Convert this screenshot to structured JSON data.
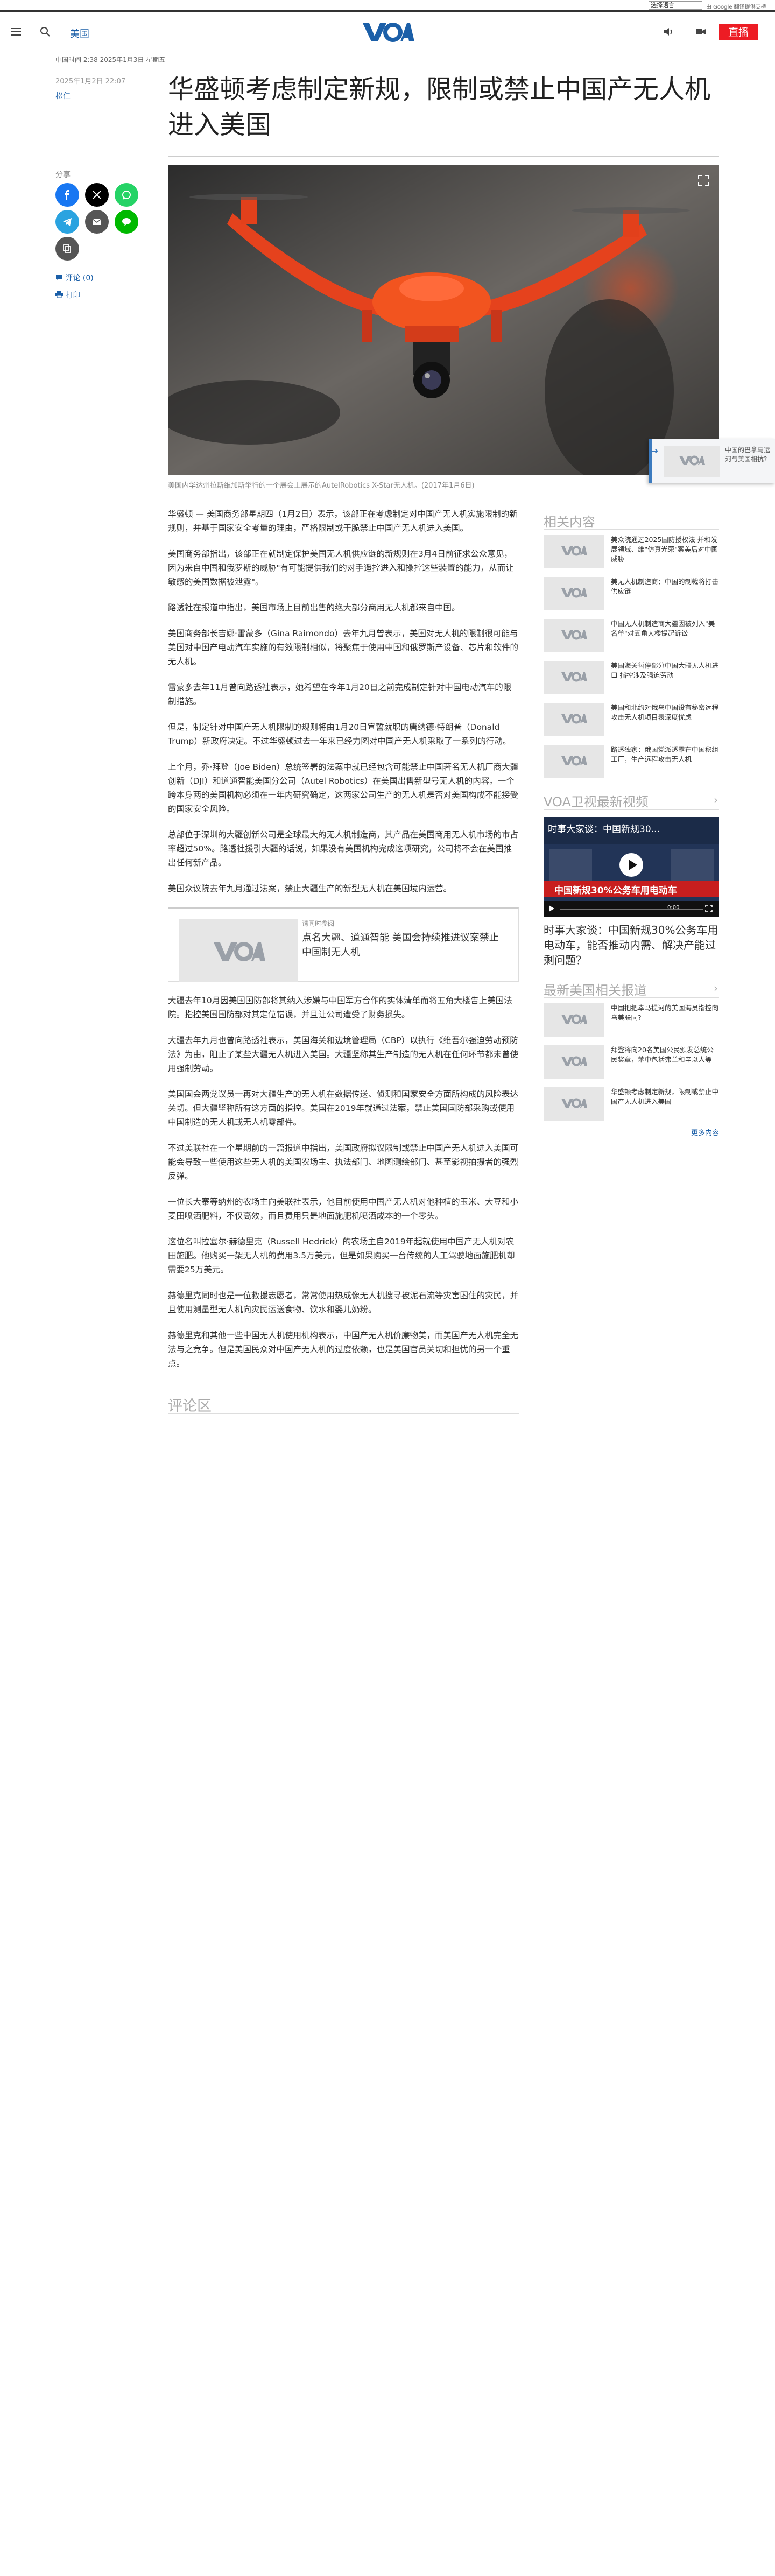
{
  "translate": {
    "select": "选择语言",
    "powered": "由 Google 翻译提供支持"
  },
  "header": {
    "section": "美国",
    "live": "直播"
  },
  "article": {
    "timestamp_line": "中国时间 2:38 2025年1月3日 星期五",
    "date": "2025年1月2日 22:07",
    "author": "松仁",
    "title": "华盛顿考虑制定新规，限制或禁止中国产无人机进入美国",
    "caption": "美国内华达州拉斯维加斯举行的一个展会上展示的AutelRobotics X-Star无人机。(2017年1月6日)",
    "paragraphs": [
      "华盛顿 — 美国商务部星期四（1月2日）表示，该部正在考虑制定对中国产无人机实施限制的新规则，并基于国家安全考量的理由，严格限制或干脆禁止中国产无人机进入美国。",
      "美国商务部指出，该部正在就制定保护美国无人机供应链的新规则在3月4日前征求公众意见，因为来自中国和俄罗斯的威胁\"有可能提供我们的对手遥控进入和操控这些装置的能力，从而让敏感的美国数据被泄露\"。",
      "路透社在报道中指出，美国市场上目前出售的绝大部分商用无人机都来自中国。",
      "美国商务部长吉娜·雷蒙多（Gina Raimondo）去年九月曾表示，美国对无人机的限制很可能与美国对中国产电动汽车实施的有效限制相似，将聚焦于使用中国和俄罗斯产设备、芯片和软件的无人机。",
      "雷蒙多去年11月曾向路透社表示，她希望在今年1月20日之前完成制定针对中国电动汽车的限制措施。",
      "但是，制定针对中国产无人机限制的规则将由1月20日宣誓就职的唐纳德·特朗普（Donald Trump）新政府决定。不过华盛顿过去一年来已经力图对中国产无人机采取了一系列的行动。",
      "上个月，乔·拜登（Joe Biden）总统签署的法案中就已经包含可能禁止中国著名无人机厂商大疆创新（DJI）和道通智能美国分公司（Autel Robotics）在美国出售新型号无人机的内容。一个跨本身两的美国机构必须在一年内研究确定，这两家公司生产的无人机是否对美国构成不能接受的国家安全风险。",
      "总部位于深圳的大疆创新公司是全球最大的无人机制造商，其产品在美国商用无人机市场的市占率超过50%。路透社援引大疆的话说，如果没有美国机构完成这项研究，公司将不会在美国推出任何新产品。",
      "美国众议院去年九月通过法案，禁止大疆生产的新型无人机在美国境内运营。"
    ],
    "related": {
      "kicker": "请同时参阅",
      "title": "点名大疆、道通智能 美国会持续推进议案禁止中国制无人机"
    },
    "paragraphs2": [
      "大疆去年10月因美国国防部将其纳入涉嫌与中国军方合作的实体清单而将五角大楼告上美国法院。指控美国国防部对其定位错误，并且让公司遭受了财务损失。",
      "大疆去年九月也曾向路透社表示，美国海关和边境管理局（CBP）以执行《维吾尔强迫劳动预防法》为由，阻止了某些大疆无人机进入美国。大疆坚称其生产制造的无人机在任何环节都未曾使用强制劳动。",
      "美国国会两党议员一再对大疆生产的无人机在数据传送、侦测和国家安全方面所构成的风险表达关切。但大疆坚称所有这方面的指控。美国在2019年就通过法案，禁止美国国防部采购或使用中国制造的无人机或无人机零部件。",
      "不过美联社在一个星期前的一篇报道中指出，美国政府拟议限制或禁止中国产无人机进入美国可能会导致一些使用这些无人机的美国农场主、执法部门、地图测绘部门、甚至影视拍摄者的强烈反弹。",
      "一位长大寨等纳州的农场主向美联社表示，他目前使用中国产无人机对他种植的玉米、大豆和小麦田喷洒肥料，不仅高效，而且费用只是地面施肥机喷洒成本的一个零头。",
      "这位名叫拉塞尔·赫德里克（Russell Hedrick）的农场主自2019年起就使用中国产无人机对农田施肥。他购买一架无人机的费用3.5万美元，但是如果购买一台传统的人工驾驶地面施肥机却需要25万美元。",
      "赫德里克同时也是一位救援志愿者，常常使用热成像无人机搜寻被泥石流等灾害困住的灾民，并且使用测量型无人机向灾民运送食物、饮水和婴儿奶粉。",
      "赫德里克和其他一些中国无人机使用机构表示，中国产无人机价廉物美，而美国产无人机完全无法与之竞争。但是美国民众对中国产无人机的过度依赖，也是美国官员关切和担忧的另一个重点。"
    ],
    "comments_title": "评论区"
  },
  "share": {
    "label": "分享",
    "comments": "评论 (0)",
    "print": "打印"
  },
  "sidebar": {
    "related_title": "相关内容",
    "related": [
      "美众院通过2025国防授权法 并和发展领域、维\"仿真光荣\"案美后对中国威胁",
      "美无人机制造商：中国的制裁将打击供应链",
      "中国无人机制造商大疆因被列入\"美名单\"对五角大楼提起诉讼",
      "美国海关暂停部分中国大疆无人机进口 指控涉及强迫劳动",
      "美国和北约对俄乌中国设有秘密远程攻击无人机项目表深度忧虑",
      "路透独家：俄国党派透露在中国秘组工厂，生产远程攻击无人机"
    ],
    "video_section": "VOA卫视最新视频",
    "video_headline": "时事大家谈：中国新规30...",
    "video_banner": "中国新规30%公务车用电动车",
    "video_time": "0:00",
    "video_title": "时事大家谈：中国新规30%公务车用电动车，能否推动内需、解决产能过剩问题？",
    "latest_section": "最新美国相关报道",
    "latest": [
      "中国把把幸马提河的美国海员指控向乌美联同?",
      "拜登将向20名美国公民颁发总统公民奖章，苯中包括弗兰和辛以人等",
      "华盛顿考虑制定新规，限制或禁止中国产无人机进入美国"
    ],
    "more": "更多内容"
  },
  "floating": {
    "text": "中国的巴拿马运河与美国相抗?"
  },
  "colors": {
    "accent": "#1b5fa8",
    "live": "#ed1c24"
  }
}
